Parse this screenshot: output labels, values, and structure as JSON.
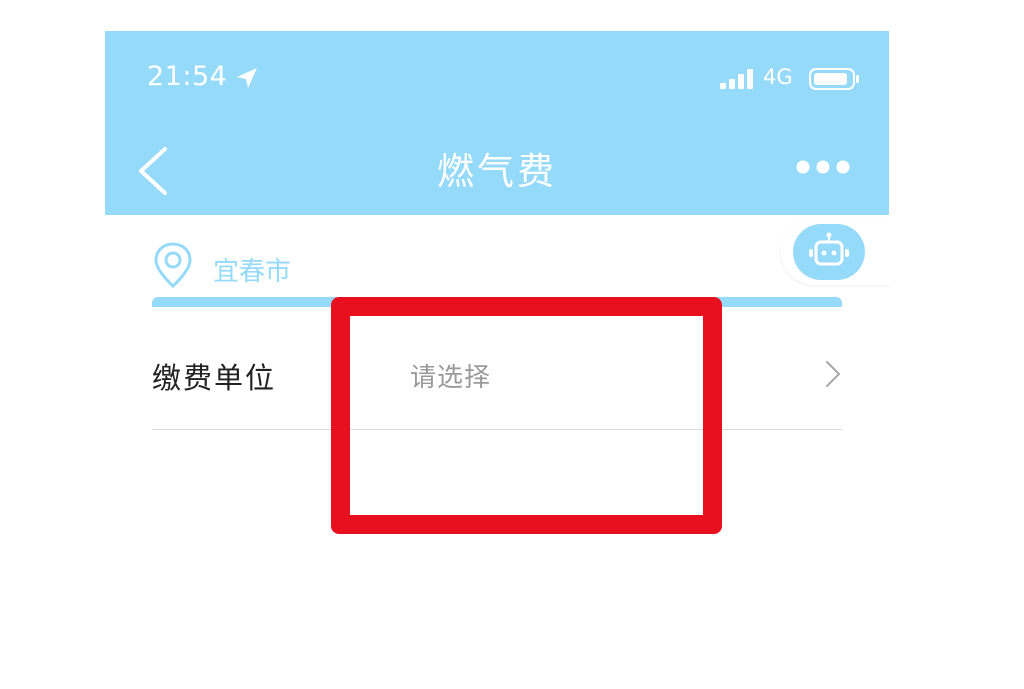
{
  "status_bar": {
    "time": "21:54",
    "location_icon": "location-arrow-icon",
    "signal_icon": "signal-bars-icon",
    "network": "4G",
    "battery_icon": "battery-icon"
  },
  "nav_bar": {
    "back_icon": "chevron-left-icon",
    "title": "燃气费",
    "more_icon": "more-dots-icon"
  },
  "location": {
    "icon": "map-pin-icon",
    "city": "宜春市"
  },
  "assistant": {
    "icon": "robot-icon"
  },
  "form": {
    "payee_row": {
      "label": "缴费单位",
      "placeholder": "请选择",
      "chevron_icon": "chevron-right-icon"
    }
  },
  "colors": {
    "header": "#96dafa",
    "accent": "#96dafa",
    "highlight": "#e8101f",
    "label_text": "#222222",
    "placeholder_text": "#9a9a9a",
    "divider": "#dcdcdc"
  }
}
